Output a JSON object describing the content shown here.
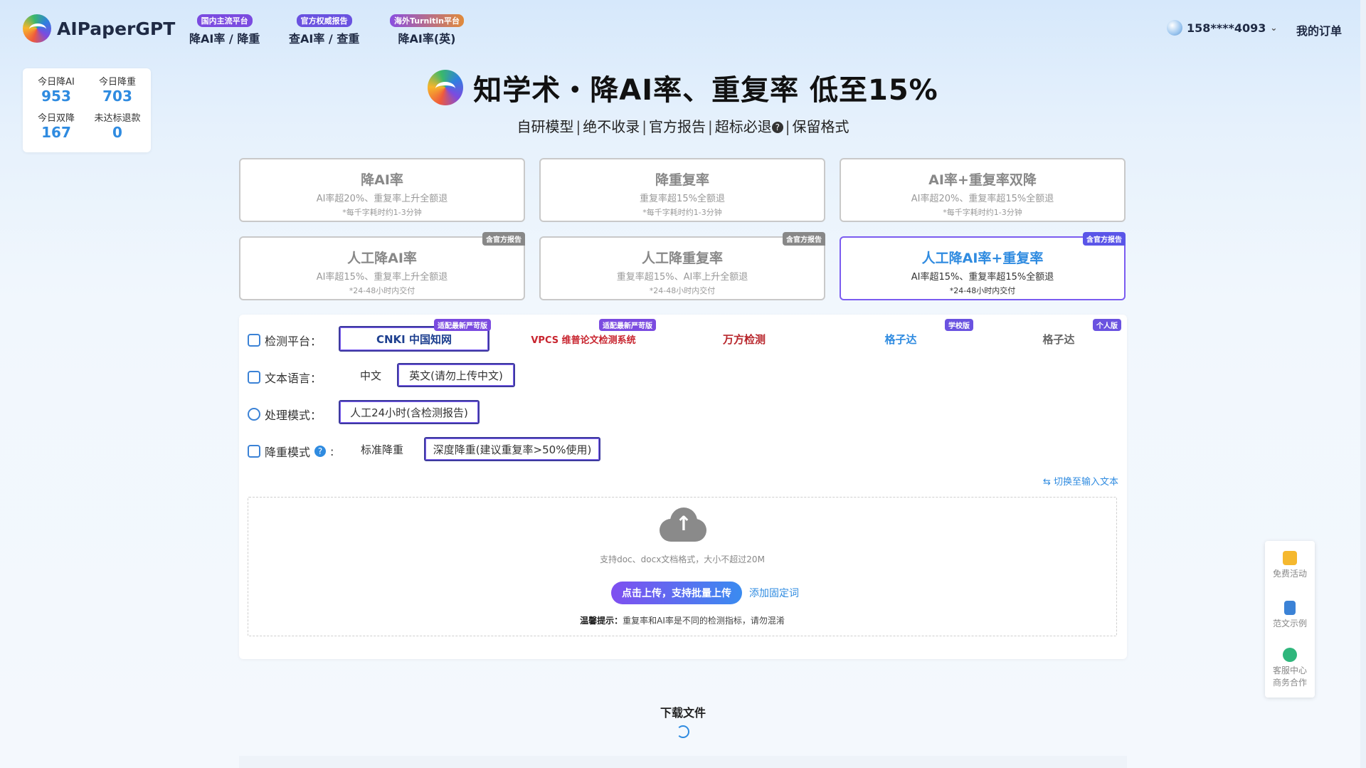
{
  "header": {
    "logo_text": "AIPaperGPT",
    "nav": [
      {
        "badge": "国内主流平台",
        "label": "降AI率 / 降重",
        "badge_color": "#7b4be0"
      },
      {
        "badge": "官方权威报告",
        "label": "查AI率 / 查重",
        "badge_color": "#6a52e0"
      },
      {
        "badge": "海外Turnitin平台",
        "label": "降AI率(英)",
        "badge_color": "#8a4fe0"
      }
    ],
    "user_phone": "158****4093",
    "orders_label": "我的订单"
  },
  "stats": [
    {
      "label": "今日降AI",
      "value": "953"
    },
    {
      "label": "今日降重",
      "value": "703"
    },
    {
      "label": "今日双降",
      "value": "167"
    },
    {
      "label": "未达标退款",
      "value": "0"
    }
  ],
  "hero": {
    "title": "知学术・降AI率、重复率 低至15%",
    "subtitle_items": [
      "自研模型",
      "绝不收录",
      "官方报告",
      "超标必退",
      "保留格式"
    ],
    "help_glyph": "?"
  },
  "services": [
    {
      "title": "降AI率",
      "desc": "AI率超20%、重复率上升全额退",
      "note": "*每千字耗时约1-3分钟",
      "tag": ""
    },
    {
      "title": "降重复率",
      "desc": "重复率超15%全额退",
      "note": "*每千字耗时约1-3分钟",
      "tag": ""
    },
    {
      "title": "AI率+重复率双降",
      "desc": "AI率超20%、重复率超15%全额退",
      "note": "*每千字耗时约1-3分钟",
      "tag": ""
    },
    {
      "title": "人工降AI率",
      "desc": "AI率超15%、重复率上升全额退",
      "note": "*24-48小时内交付",
      "tag": "含官方报告"
    },
    {
      "title": "人工降重复率",
      "desc": "重复率超15%、AI率上升全额退",
      "note": "*24-48小时内交付",
      "tag": "含官方报告"
    },
    {
      "title": "人工降AI率+重复率",
      "desc": "AI率超15%、重复率超15%全额退",
      "note": "*24-48小时内交付",
      "tag": "含官方报告",
      "selected": true
    }
  ],
  "form": {
    "platform_label": "检测平台：",
    "platforms": [
      {
        "name": "CNKI 中国知网",
        "tag": "适配最新严苛版",
        "selected": true
      },
      {
        "name": "VPCS 维普论文检测系统",
        "tag": "适配最新严苛版"
      },
      {
        "name": "万方检测",
        "tag": ""
      },
      {
        "name": "格子达",
        "tag": "学校版"
      },
      {
        "name": "格子达",
        "tag": "个人版"
      }
    ],
    "language_label": "文本语言：",
    "languages": [
      "中文",
      "英文(请勿上传中文)"
    ],
    "mode_label": "处理模式：",
    "modes": [
      "人工24小时(含检测报告)"
    ],
    "dedup_label": "降重模式",
    "dedup_colon": ":",
    "dedup_options": [
      "标准降重",
      "深度降重(建议重复率>50%使用)"
    ],
    "switch_text": "⇆ 切换至输入文本"
  },
  "upload": {
    "hint": "支持doc、docx文档格式，大小不超过20M",
    "button": "点击上传，支持批量上传",
    "fixed_words": "添加固定词",
    "tip_label": "温馨提示：",
    "tip_text": "重复率和AI率是不同的检测指标，请勿混淆"
  },
  "download": {
    "title": "下载文件"
  },
  "floatbar": [
    {
      "label": "免费活动",
      "icon": "gift-icon",
      "color": "#f5b82e"
    },
    {
      "label": "范文示例",
      "icon": "document-icon",
      "color": "#3b82d6"
    },
    {
      "label": "客服中心",
      "label2": "商务合作",
      "icon": "headset-icon",
      "color": "#2fb67c"
    }
  ]
}
